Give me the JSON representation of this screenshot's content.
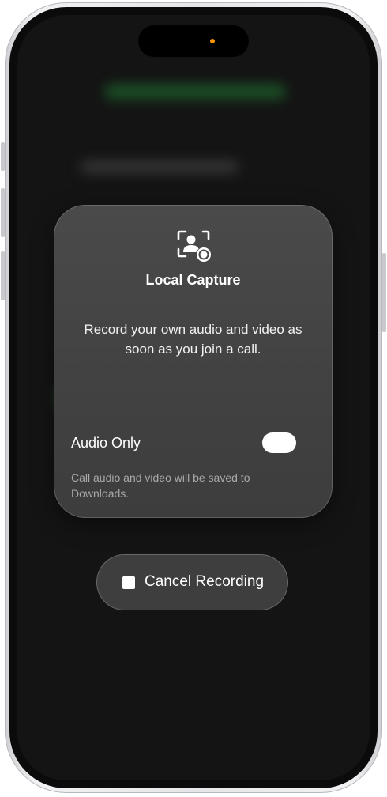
{
  "capture_card": {
    "icon": "person-capture-icon",
    "title": "Local Capture",
    "description": "Record your own audio and video as soon as you join a call.",
    "option": {
      "label": "Audio Only",
      "enabled": true,
      "note": "Call audio and video will be saved to Downloads."
    }
  },
  "cancel_button": {
    "icon": "stop-icon",
    "label": "Cancel Recording"
  },
  "status": {
    "recording_indicator": "orange-dot",
    "indicator_color": "#ff9500"
  },
  "colors": {
    "screen_background": "#141414",
    "card_background": "#464646",
    "toggle_on": "#ffffff"
  }
}
